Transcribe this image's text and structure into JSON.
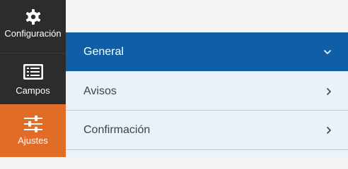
{
  "sidebar": {
    "items": [
      {
        "label": "Configuración",
        "icon": "gear-icon"
      },
      {
        "label": "Campos",
        "icon": "list-icon"
      },
      {
        "label": "Ajustes",
        "icon": "sliders-icon"
      }
    ],
    "active_index": 2,
    "background_color": "#2c2c2c",
    "active_color": "#e06c27"
  },
  "settings": {
    "sections": [
      {
        "label": "General",
        "expanded": true,
        "icon": "chevron-down-icon"
      },
      {
        "label": "Avisos",
        "expanded": false,
        "icon": "chevron-right-icon"
      },
      {
        "label": "Confirmación",
        "expanded": false,
        "icon": "chevron-right-icon"
      }
    ],
    "active_color": "#0e5fa6"
  }
}
